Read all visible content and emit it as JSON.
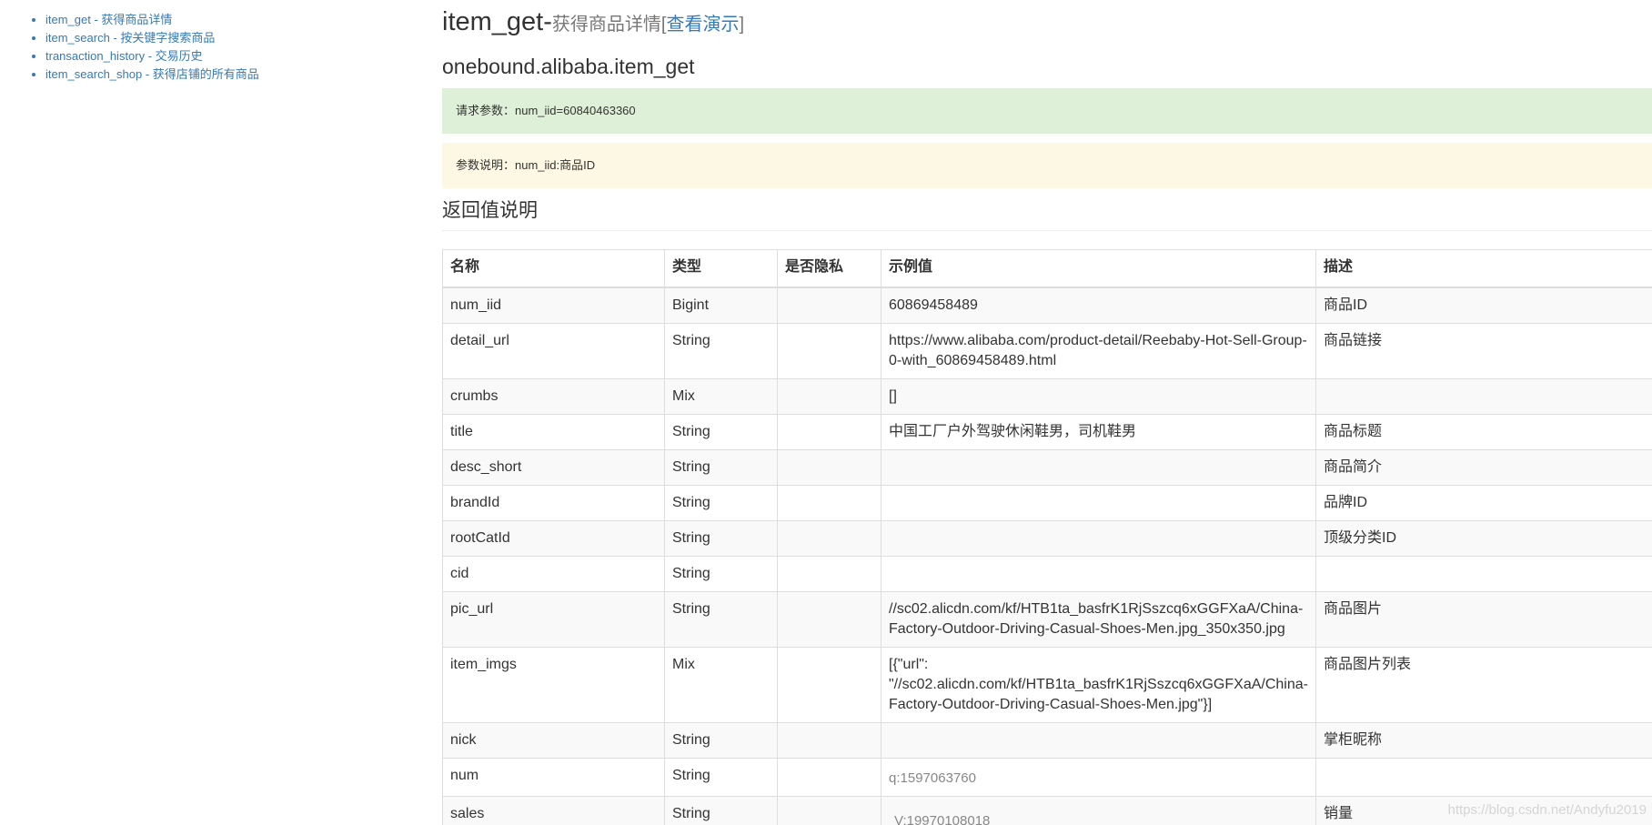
{
  "sidebar": {
    "links": [
      "item_get - 获得商品详情",
      "item_search - 按关键字搜索商品",
      "transaction_history - 交易历史",
      "item_search_shop - 获得店铺的所有商品"
    ]
  },
  "header": {
    "title": "item_get-",
    "subtitle": "获得商品详情",
    "demo_open": "[",
    "demo_link": "查看演示",
    "demo_close": "]"
  },
  "api_name": "onebound.alibaba.item_get",
  "request_params": "请求参数：num_iid=60840463360",
  "param_desc": "参数说明：num_iid:商品ID",
  "return_section_title": "返回值说明",
  "table": {
    "headers": [
      "名称",
      "类型",
      "是否隐私",
      "示例值",
      "描述"
    ],
    "rows": [
      [
        "num_iid",
        "Bigint",
        "",
        "60869458489",
        "商品ID"
      ],
      [
        "detail_url",
        "String",
        "",
        "https://www.alibaba.com/product-detail/Reebaby-Hot-Sell-Group-0-with_60869458489.html",
        "商品链接"
      ],
      [
        "crumbs",
        "Mix",
        "",
        "[]",
        ""
      ],
      [
        "title",
        "String",
        "",
        "中国工厂户外驾驶休闲鞋男，司机鞋男",
        "商品标题"
      ],
      [
        "desc_short",
        "String",
        "",
        "",
        "商品简介"
      ],
      [
        "brandId",
        "String",
        "",
        "",
        "品牌ID"
      ],
      [
        "rootCatId",
        "String",
        "",
        "",
        "顶级分类ID"
      ],
      [
        "cid",
        "String",
        "",
        "",
        ""
      ],
      [
        "pic_url",
        "String",
        "",
        "//sc02.alicdn.com/kf/HTB1ta_basfrK1RjSszcq6xGGFXaA/China-Factory-Outdoor-Driving-Casual-Shoes-Men.jpg_350x350.jpg",
        "商品图片"
      ],
      [
        "item_imgs",
        "Mix",
        "",
        "[{\"url\": \"//sc02.alicdn.com/kf/HTB1ta_basfrK1RjSszcq6xGGFXaA/China-Factory-Outdoor-Driving-Casual-Shoes-Men.jpg\"}]",
        "商品图片列表"
      ],
      [
        "nick",
        "String",
        "",
        "",
        "掌柜昵称"
      ],
      [
        "num",
        "String",
        "",
        "q:1597063760",
        ""
      ],
      [
        "sales",
        "String",
        "",
        "V:19970108018",
        "销量"
      ]
    ]
  },
  "watermark": "https://blog.csdn.net/Andyfu2019"
}
